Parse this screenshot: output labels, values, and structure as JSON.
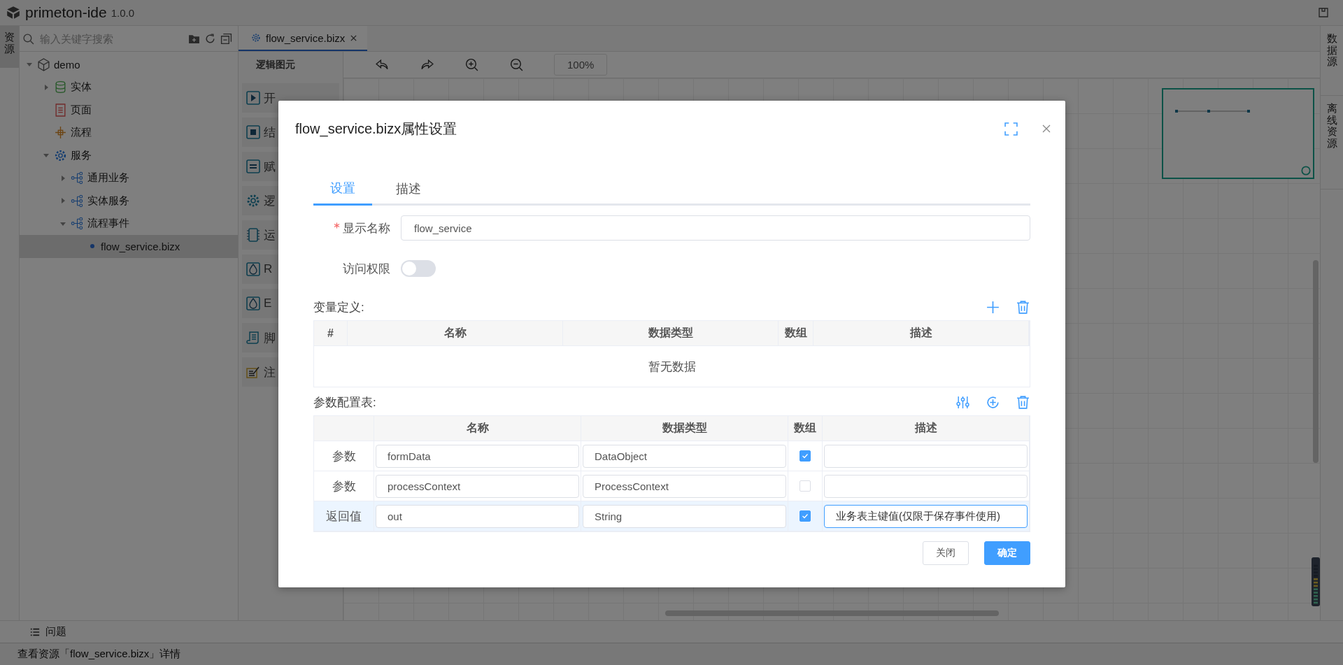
{
  "app": {
    "name": "primeton-ide",
    "version": "1.0.0"
  },
  "left_strip": [
    {
      "label": "资源",
      "selected": true
    }
  ],
  "search": {
    "placeholder": "输入关键字搜索"
  },
  "tree": [
    {
      "label": "demo",
      "kind": "package",
      "expanded": true,
      "selected": false,
      "children": [
        {
          "label": "实体",
          "kind": "database",
          "expanded": false,
          "selected": false
        },
        {
          "label": "页面",
          "kind": "page",
          "selected": false
        },
        {
          "label": "流程",
          "kind": "flow",
          "selected": false
        },
        {
          "label": "服务",
          "kind": "gear",
          "expanded": true,
          "selected": false,
          "children": [
            {
              "label": "通用业务",
              "kind": "service",
              "expanded": false,
              "selected": false
            },
            {
              "label": "实体服务",
              "kind": "service",
              "expanded": false,
              "selected": false
            },
            {
              "label": "流程事件",
              "kind": "service",
              "expanded": true,
              "selected": false,
              "children": [
                {
                  "label": "flow_service.bizx",
                  "kind": "dot",
                  "selected": true
                }
              ]
            }
          ]
        }
      ]
    }
  ],
  "editor_tabs": [
    {
      "label": "flow_service.bizx",
      "selected": true
    }
  ],
  "palette": {
    "title": "逻辑图元",
    "items": [
      {
        "label": "开",
        "kind": "play"
      },
      {
        "label": "结",
        "kind": "stop"
      },
      {
        "label": "赋",
        "kind": "equals"
      },
      {
        "label": "逻",
        "kind": "gear"
      },
      {
        "label": "运",
        "kind": "chip"
      },
      {
        "label": "R",
        "kind": "r-drop"
      },
      {
        "label": "E",
        "kind": "e-drop"
      },
      {
        "label": "脚",
        "kind": "script"
      },
      {
        "label": "注",
        "kind": "note"
      }
    ]
  },
  "toolbar": {
    "zoom": "100%"
  },
  "right_strip": [
    {
      "label": "数据源",
      "selected": false
    },
    {
      "label": "离线资源",
      "selected": false
    }
  ],
  "bottom_panel": {
    "label": "问题"
  },
  "status_bar": "查看资源「flow_service.bizx」详情",
  "dialog": {
    "title": "flow_service.bizx属性设置",
    "tabs": [
      {
        "label": "设置",
        "selected": true
      },
      {
        "label": "描述",
        "selected": false
      }
    ],
    "display_name": {
      "label": "显示名称",
      "required": true,
      "value": "flow_service"
    },
    "access": {
      "label": "访问权限",
      "on": false
    },
    "variables": {
      "title": "变量定义:",
      "columns": [
        "#",
        "名称",
        "数据类型",
        "数组",
        "描述"
      ],
      "empty": "暂无数据"
    },
    "params": {
      "title": "参数配置表:",
      "columns": [
        "名称",
        "数据类型",
        "数组",
        "描述"
      ],
      "rows": [
        {
          "kind_label": "参数",
          "name": "formData",
          "type": "DataObject",
          "array": true,
          "description": "",
          "selected": false
        },
        {
          "kind_label": "参数",
          "name": "processContext",
          "type": "ProcessContext",
          "array": false,
          "description": "",
          "selected": false
        },
        {
          "kind_label": "返回值",
          "name": "out",
          "type": "String",
          "array": true,
          "description": "业务表主键值(仅限于保存事件使用)",
          "selected": true
        }
      ]
    },
    "buttons": [
      {
        "label": "关闭",
        "kind": "default"
      },
      {
        "label": "确定",
        "kind": "primary"
      }
    ]
  }
}
